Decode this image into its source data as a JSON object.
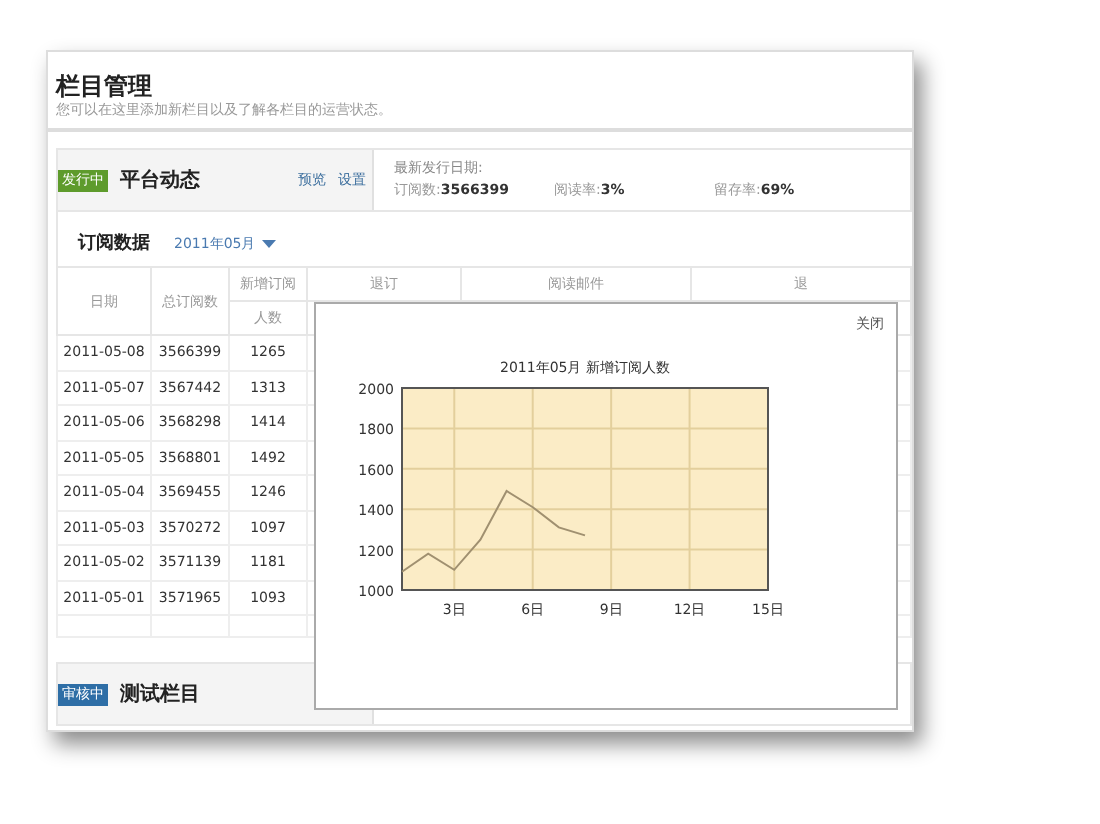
{
  "header": {
    "title": "栏目管理",
    "subtitle": "您可以在这里添加新栏目以及了解各栏目的运营状态。"
  },
  "channels": [
    {
      "color": "#5e9b2c",
      "badge": "发行中",
      "name": "平台动态",
      "links": [
        "预览",
        "设置"
      ],
      "stats_title": "最新发行日期:",
      "stats": [
        {
          "label": "订阅数:",
          "value": "3566399"
        },
        {
          "label": "阅读率:",
          "value": "3%"
        },
        {
          "label": "留存率:",
          "value": "69%"
        }
      ]
    },
    {
      "color": "#2e6ea6",
      "badge": "审核中",
      "name": "测试栏目"
    }
  ],
  "subscription": {
    "title": "订阅数据",
    "month": "2011年05月"
  },
  "table": {
    "columns": [
      {
        "kind": "tall",
        "label": "日期"
      },
      {
        "kind": "tall",
        "label": "总订阅数"
      },
      {
        "kind": "group",
        "label": "新增订阅",
        "sub": "人数"
      },
      {
        "kind": "group",
        "label": "退订"
      },
      {
        "kind": "group",
        "label": "阅读邮件"
      },
      {
        "kind": "group",
        "label": "退"
      }
    ],
    "rows": [
      [
        "2011-05-08",
        "3566399",
        "1265"
      ],
      [
        "2011-05-07",
        "3567442",
        "1313"
      ],
      [
        "2011-05-06",
        "3568298",
        "1414"
      ],
      [
        "2011-05-05",
        "3568801",
        "1492"
      ],
      [
        "2011-05-04",
        "3569455",
        "1246"
      ],
      [
        "2011-05-03",
        "3570272",
        "1097"
      ],
      [
        "2011-05-02",
        "3571139",
        "1181"
      ],
      [
        "2011-05-01",
        "3571965",
        "1093"
      ]
    ]
  },
  "popup": {
    "close": "关闭",
    "chart_data": {
      "type": "line",
      "title": "2011年05月 新增订阅人数",
      "x": [
        1,
        2,
        3,
        4,
        5,
        6,
        7,
        8
      ],
      "series": [
        {
          "color": "#a09070",
          "values": [
            1090,
            1180,
            1100,
            1250,
            1490,
            1410,
            1310,
            1270
          ]
        }
      ],
      "grid": true,
      "xlim": [
        1,
        15
      ],
      "ylim": [
        1000,
        2000
      ],
      "xticks": [
        {
          "value": 3,
          "label": "3日"
        },
        {
          "value": 6,
          "label": "6日"
        },
        {
          "value": 9,
          "label": "9日"
        },
        {
          "value": 12,
          "label": "12日"
        },
        {
          "value": 15,
          "label": "15日"
        }
      ],
      "yticks": [
        1000,
        1200,
        1400,
        1600,
        1800,
        2000
      ]
    }
  }
}
